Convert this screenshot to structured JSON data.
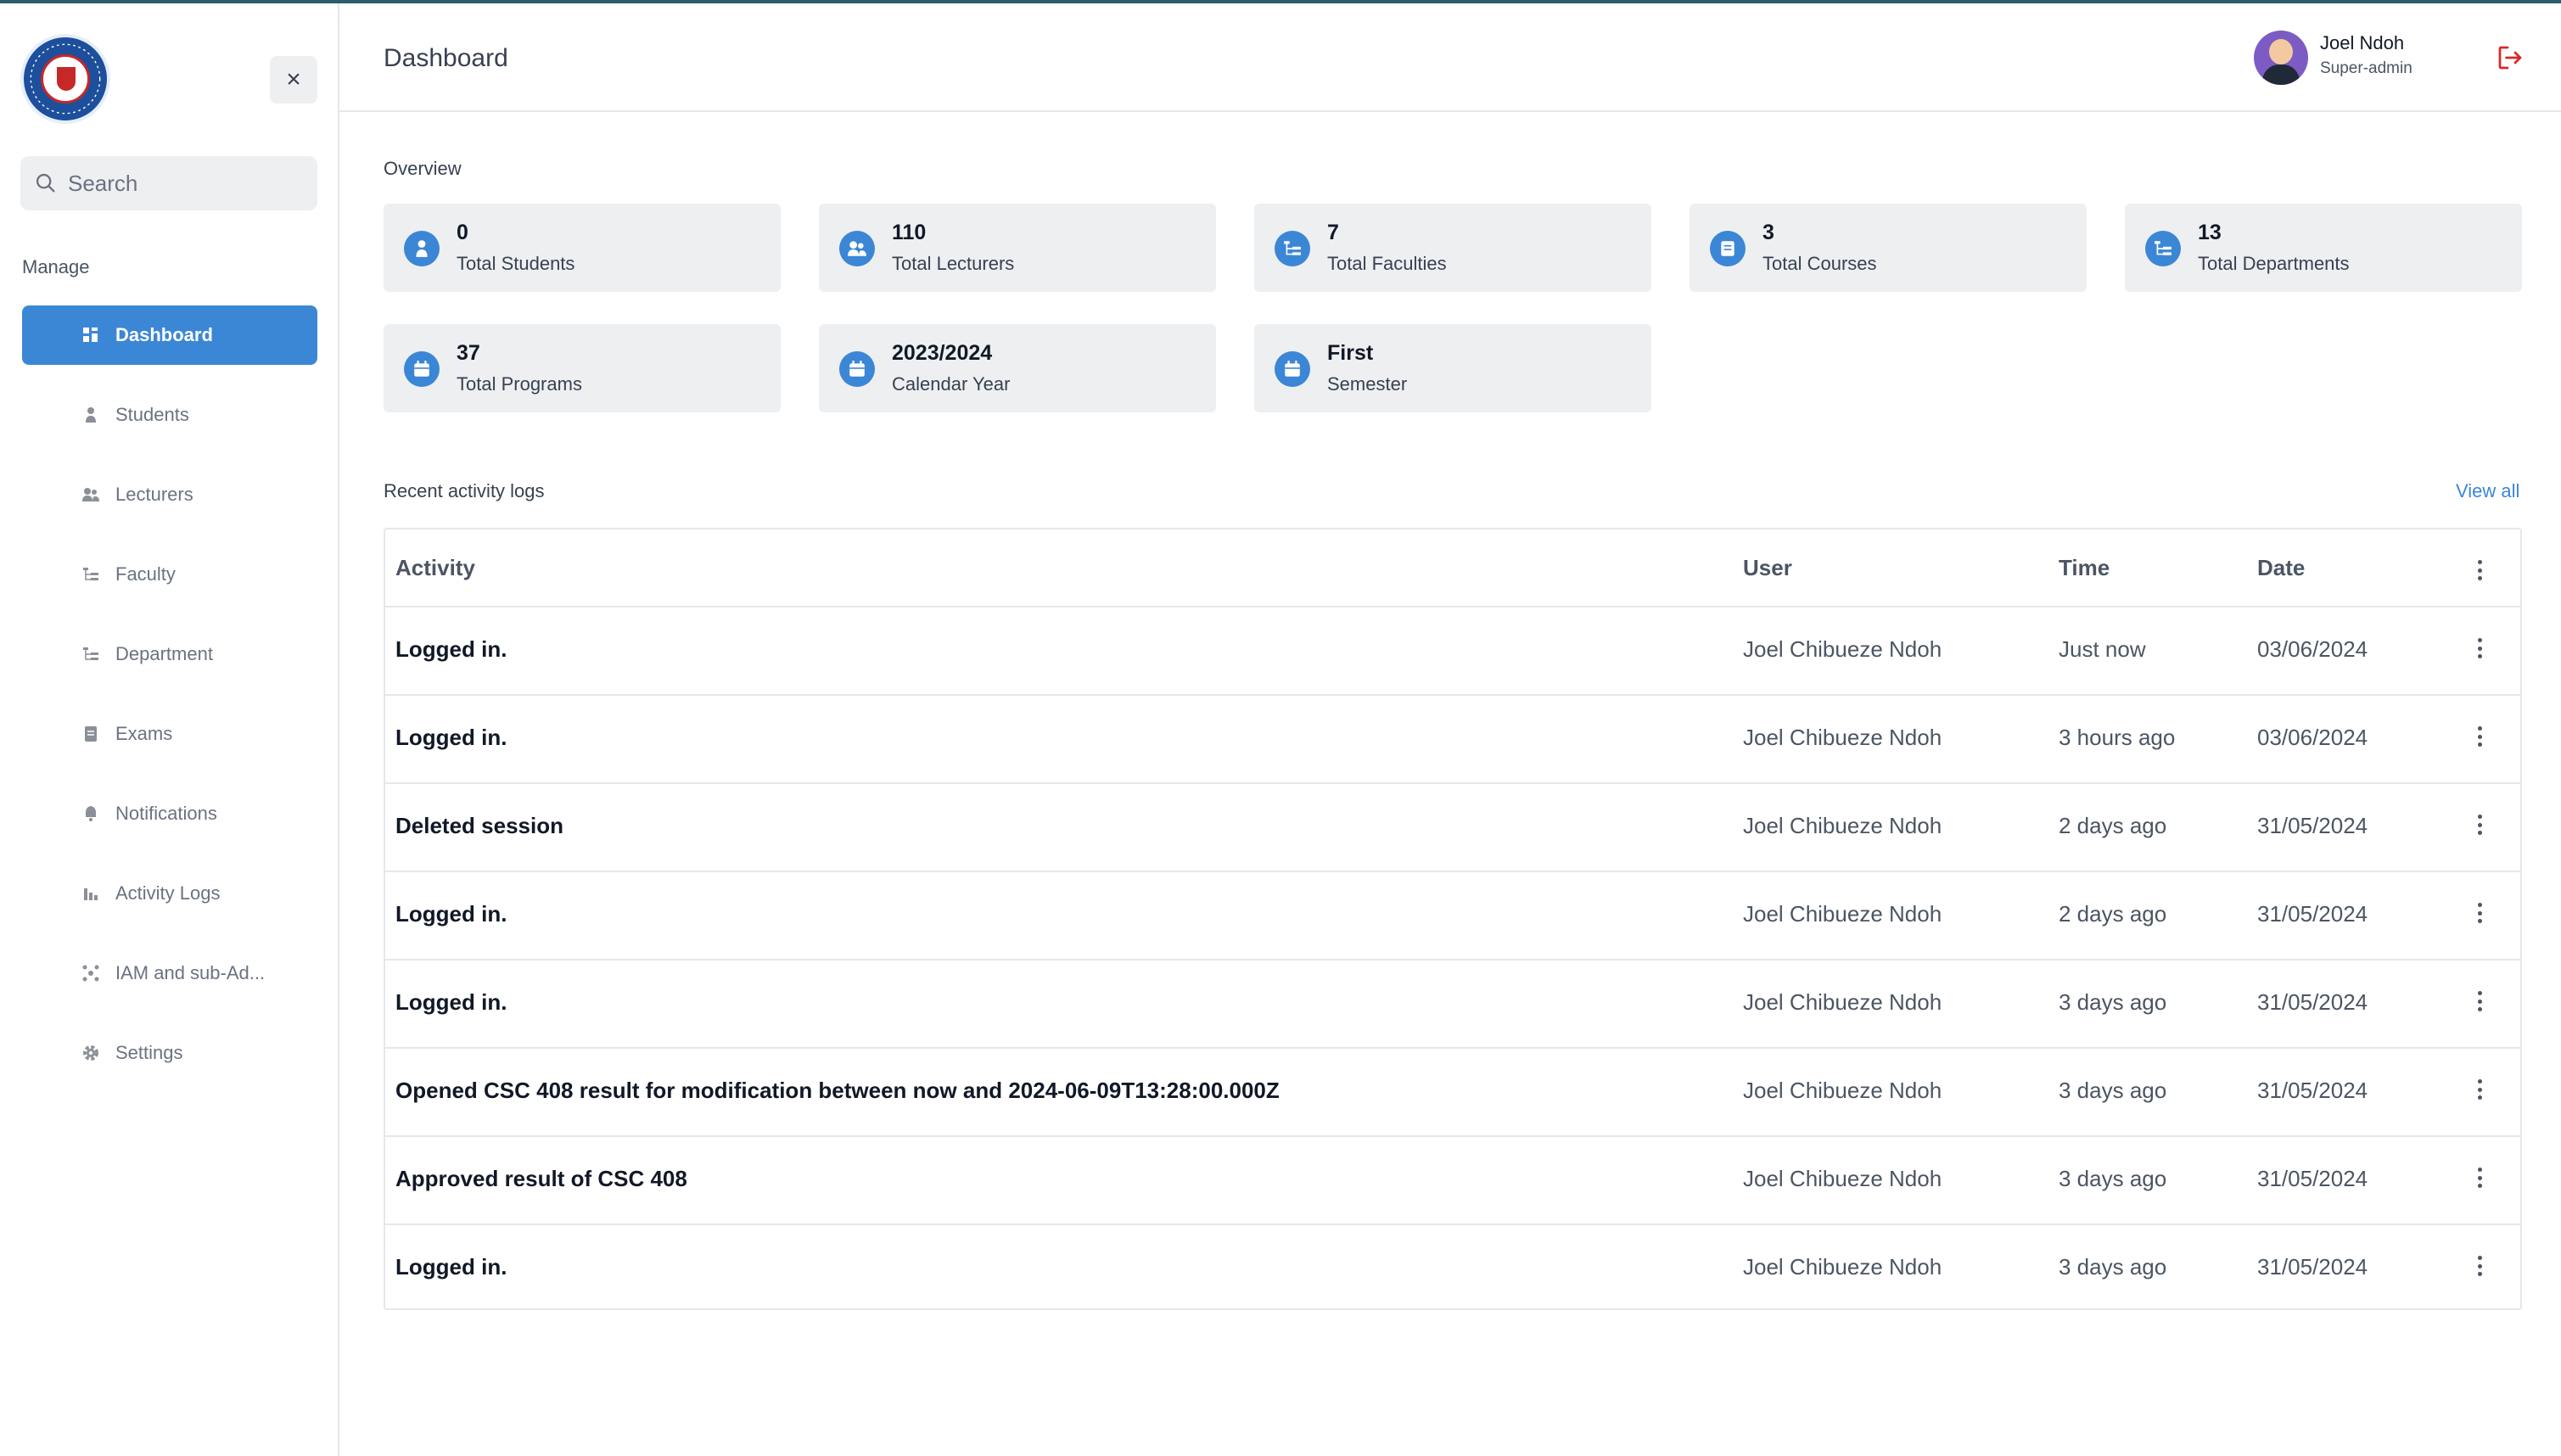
{
  "sidebar": {
    "logo_text": "Lead City University Ibadan",
    "search_placeholder": "Search",
    "section_label": "Manage",
    "items": [
      {
        "label": "Dashboard",
        "icon": "grid-icon",
        "active": true
      },
      {
        "label": "Students",
        "icon": "person-icon"
      },
      {
        "label": "Lecturers",
        "icon": "people-icon"
      },
      {
        "label": "Faculty",
        "icon": "tree-icon"
      },
      {
        "label": "Department",
        "icon": "tree-icon"
      },
      {
        "label": "Exams",
        "icon": "document-icon"
      },
      {
        "label": "Notifications",
        "icon": "bell-icon"
      },
      {
        "label": "Activity Logs",
        "icon": "bar-chart-icon"
      },
      {
        "label": "IAM and sub-Ad...",
        "icon": "network-icon"
      },
      {
        "label": "Settings",
        "icon": "gear-icon"
      }
    ]
  },
  "header": {
    "title": "Dashboard",
    "user_name": "Joel Ndoh",
    "user_role": "Super-admin"
  },
  "overview": {
    "label": "Overview",
    "cards": [
      {
        "value": "0",
        "label": "Total Students",
        "icon": "person-icon"
      },
      {
        "value": "110",
        "label": "Total Lecturers",
        "icon": "people-icon"
      },
      {
        "value": "7",
        "label": "Total Faculties",
        "icon": "tree-icon"
      },
      {
        "value": "3",
        "label": "Total Courses",
        "icon": "book-icon"
      },
      {
        "value": "13",
        "label": "Total Departments",
        "icon": "tree-icon"
      },
      {
        "value": "37",
        "label": "Total Programs",
        "icon": "calendar-icon"
      },
      {
        "value": "2023/2024",
        "label": "Calendar Year",
        "icon": "calendar-icon"
      },
      {
        "value": "First",
        "label": "Semester",
        "icon": "calendar-icon"
      }
    ]
  },
  "logs": {
    "label": "Recent activity logs",
    "view_all": "View all",
    "columns": {
      "activity": "Activity",
      "user": "User",
      "time": "Time",
      "date": "Date"
    },
    "rows": [
      {
        "activity": "Logged in.",
        "user": "Joel Chibueze Ndoh",
        "time": "Just now",
        "date": "03/06/2024"
      },
      {
        "activity": "Logged in.",
        "user": "Joel Chibueze Ndoh",
        "time": "3 hours ago",
        "date": "03/06/2024"
      },
      {
        "activity": "Deleted session",
        "user": "Joel Chibueze Ndoh",
        "time": "2 days ago",
        "date": "31/05/2024"
      },
      {
        "activity": "Logged in.",
        "user": "Joel Chibueze Ndoh",
        "time": "2 days ago",
        "date": "31/05/2024"
      },
      {
        "activity": "Logged in.",
        "user": "Joel Chibueze Ndoh",
        "time": "3 days ago",
        "date": "31/05/2024"
      },
      {
        "activity": "Opened CSC 408 result for modification between now and 2024-06-09T13:28:00.000Z",
        "user": "Joel Chibueze Ndoh",
        "time": "3 days ago",
        "date": "31/05/2024"
      },
      {
        "activity": "Approved result of CSC 408",
        "user": "Joel Chibueze Ndoh",
        "time": "3 days ago",
        "date": "31/05/2024"
      },
      {
        "activity": "Logged in.",
        "user": "Joel Chibueze Ndoh",
        "time": "3 days ago",
        "date": "31/05/2024"
      }
    ]
  },
  "colors": {
    "accent": "#3b87d6",
    "card_bg": "#eeeff1",
    "logout": "#dc2626"
  }
}
